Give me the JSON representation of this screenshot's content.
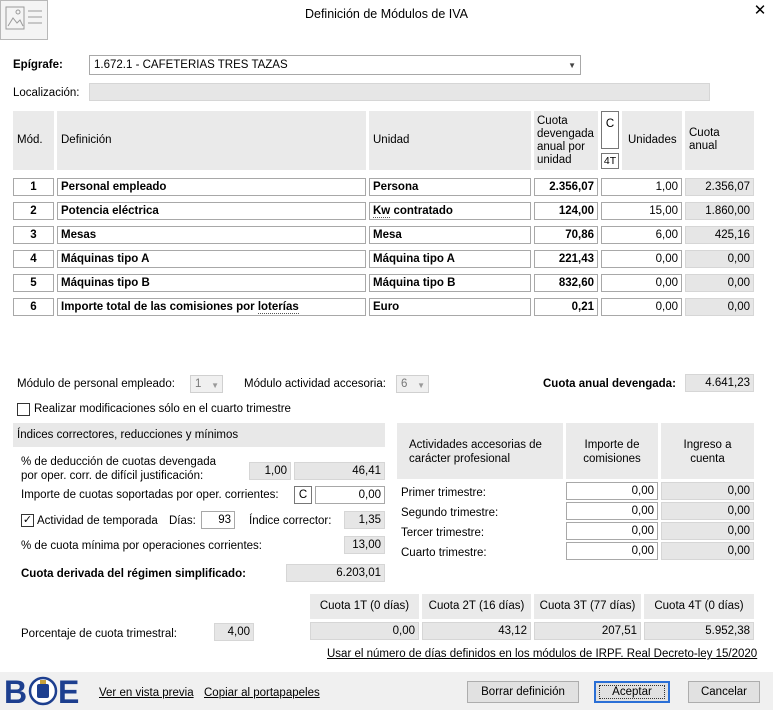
{
  "window": {
    "title": "Definición de Módulos de IVA"
  },
  "epigrafe": {
    "label": "Epígrafe:",
    "value": "1.672.1 - CAFETERIAS TRES TAZAS"
  },
  "localizacion": {
    "label": "Localización:",
    "value": ""
  },
  "table": {
    "headers": {
      "mod": "Mód.",
      "definicion": "Definición",
      "unidad": "Unidad",
      "cuota": "Cuota devengada anual por unidad",
      "c_button": "C",
      "fourt_button": "4T",
      "unidades": "Unidades",
      "cuota_anual": "Cuota anual"
    },
    "rows": [
      {
        "mod": "1",
        "definicion": "Personal empleado",
        "unidad": "Persona",
        "cuota": "2.356,07",
        "unidades": "1,00",
        "anual": "2.356,07"
      },
      {
        "mod": "2",
        "definicion": "Potencia eléctrica",
        "unidad": "Kw contratado",
        "cuota": "124,00",
        "unidades": "15,00",
        "anual": "1.860,00"
      },
      {
        "mod": "3",
        "definicion": "Mesas",
        "unidad": "Mesa",
        "cuota": "70,86",
        "unidades": "6,00",
        "anual": "425,16"
      },
      {
        "mod": "4",
        "definicion": "Máquinas tipo A",
        "unidad": "Máquina tipo A",
        "cuota": "221,43",
        "unidades": "0,00",
        "anual": "0,00"
      },
      {
        "mod": "5",
        "definicion": "Máquinas tipo B",
        "unidad": "Máquina tipo B",
        "cuota": "832,60",
        "unidades": "0,00",
        "anual": "0,00"
      },
      {
        "mod": "6",
        "definicion": "Importe total de las comisiones por loterías",
        "unidad": "Euro",
        "cuota": "0,21",
        "unidades": "0,00",
        "anual": "0,00"
      }
    ]
  },
  "modulo_personal": {
    "label": "Módulo de personal empleado:",
    "value": "1"
  },
  "modulo_accesoria": {
    "label": "Módulo actividad accesoria:",
    "value": "6"
  },
  "cuota_anual_devengada": {
    "label": "Cuota anual devengada:",
    "value": "4.641,23"
  },
  "realizar_mod": {
    "label": "Realizar modificaciones sólo en el cuarto trimestre",
    "checked": false
  },
  "indices": {
    "title": "Índices correctores, reducciones y mínimos",
    "deduccion_label_1": "% de deducción de cuotas devengada",
    "deduccion_label_2": "por oper. corr. de difícil justificación:",
    "deduccion_pct": "1,00",
    "deduccion_value": "46,41",
    "soportadas_label": "Importe de cuotas soportadas por oper. corrientes:",
    "soportadas_c": "C",
    "soportadas_value": "0,00",
    "temporada_label": "Actividad de temporada",
    "temporada_checked": true,
    "dias_label": "Días:",
    "dias_value": "93",
    "indice_label": "Índice corrector:",
    "indice_value": "1,35",
    "minima_label": "% de cuota mínima por operaciones corrientes:",
    "minima_value": "13,00",
    "derivada_label": "Cuota derivada del régimen simplificado:",
    "derivada_value": "6.203,01"
  },
  "accesorias": {
    "title": "Actividades accesorias de carácter profesional",
    "col_comisiones": "Importe de comisiones",
    "col_ingreso": "Ingreso a cuenta",
    "rows": [
      {
        "label": "Primer trimestre:",
        "comisiones": "0,00",
        "ingreso": "0,00"
      },
      {
        "label": "Segundo trimestre:",
        "comisiones": "0,00",
        "ingreso": "0,00"
      },
      {
        "label": "Tercer trimestre:",
        "comisiones": "0,00",
        "ingreso": "0,00"
      },
      {
        "label": "Cuarto trimestre:",
        "comisiones": "0,00",
        "ingreso": "0,00"
      }
    ]
  },
  "trimestral": {
    "headers": [
      "Cuota 1T (0 días)",
      "Cuota 2T (16 días)",
      "Cuota 3T (77 días)",
      "Cuota 4T (0 días)"
    ],
    "label": "Porcentaje de cuota trimestral:",
    "pct": "4,00",
    "values": [
      "0,00",
      "43,12",
      "207,51",
      "5.952,38"
    ]
  },
  "irpf_link": "Usar el número de días definidos en los módulos de IRPF. Real Decreto-ley 15/2020",
  "footer": {
    "logo_text": "BOE",
    "vista_previa": "Ver en vista previa",
    "copiar": "Copiar al portapapeles",
    "borrar": "Borrar definición",
    "aceptar": "Aceptar",
    "cancelar": "Cancelar"
  }
}
